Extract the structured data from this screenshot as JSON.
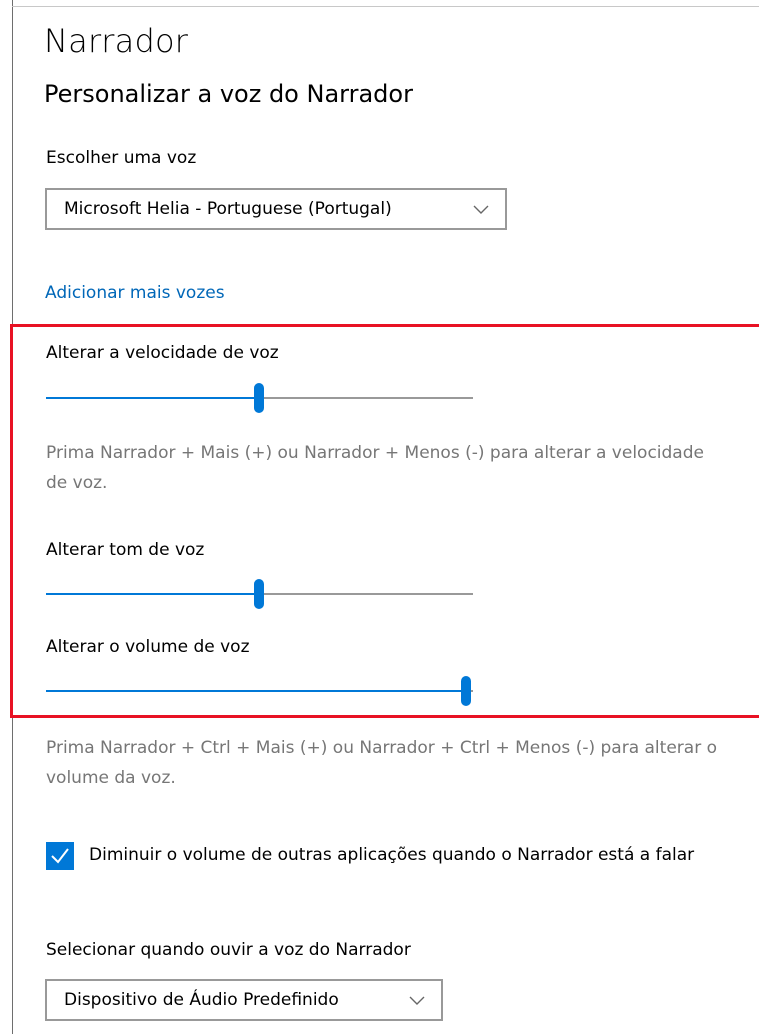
{
  "header": {
    "title": "Narrador",
    "subtitle": "Personalizar a voz do Narrador"
  },
  "voice": {
    "label": "Escolher uma voz",
    "selected": "Microsoft Helia - Portuguese (Portugal)",
    "add_voices_link": "Adicionar mais vozes"
  },
  "speed": {
    "label": "Alterar a velocidade de voz",
    "value_fraction": 0.5,
    "help": "Prima Narrador + Mais (+) ou Narrador + Menos (-) para alterar a velocidade de voz."
  },
  "pitch": {
    "label": "Alterar tom de voz",
    "value_fraction": 0.5
  },
  "volume": {
    "label": "Alterar o volume de voz",
    "value_fraction": 1.0,
    "help": "Prima Narrador + Ctrl + Mais (+) ou Narrador + Ctrl + Menos (-) para alterar o volume da voz."
  },
  "lower_volume": {
    "checked": true,
    "label": "Diminuir o volume de outras aplicações quando o Narrador está a falar"
  },
  "audio_output": {
    "label": "Selecionar quando ouvir a voz do Narrador",
    "selected": "Dispositivo de Áudio Predefinido"
  },
  "colors": {
    "accent": "#0078d7",
    "link": "#0067b8",
    "highlight_border": "#e81123",
    "help_text": "#767676"
  },
  "icons": {
    "dropdown": "chevron-down-icon",
    "checkbox": "checkmark-icon"
  }
}
